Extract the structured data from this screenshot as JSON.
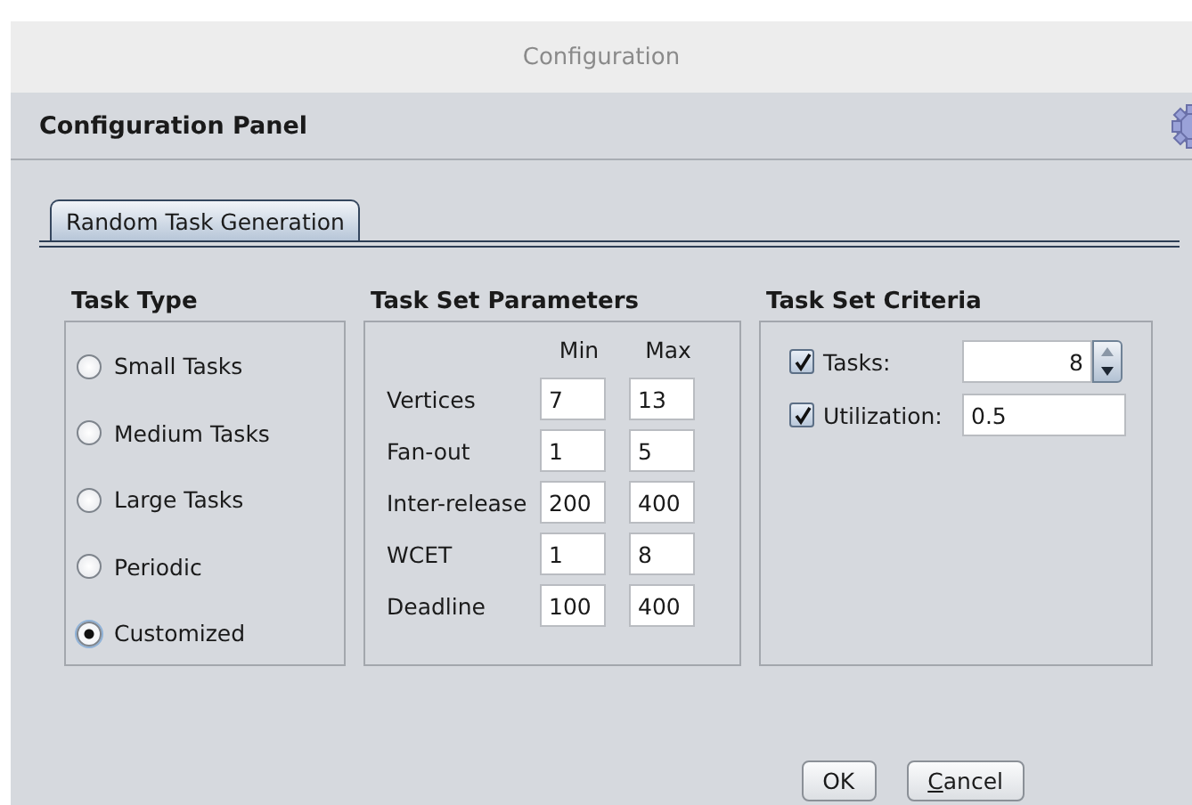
{
  "window": {
    "title": "Configuration"
  },
  "header": {
    "title": "Configuration Panel"
  },
  "tabs": [
    {
      "label": "Random Task Generation",
      "selected": true
    }
  ],
  "task_type": {
    "title": "Task Type",
    "options": [
      {
        "label": "Small Tasks",
        "selected": false
      },
      {
        "label": "Medium Tasks",
        "selected": false
      },
      {
        "label": "Large Tasks",
        "selected": false
      },
      {
        "label": "Periodic",
        "selected": false
      },
      {
        "label": "Customized",
        "selected": true
      }
    ]
  },
  "parameters": {
    "title": "Task Set Parameters",
    "columns": [
      "Min",
      "Max"
    ],
    "rows": [
      {
        "label": "Vertices",
        "min": "7",
        "max": "13"
      },
      {
        "label": "Fan-out",
        "min": "1",
        "max": "5"
      },
      {
        "label": "Inter-release",
        "min": "200",
        "max": "400"
      },
      {
        "label": "WCET",
        "min": "1",
        "max": "8"
      },
      {
        "label": "Deadline",
        "min": "100",
        "max": "400"
      }
    ]
  },
  "criteria": {
    "title": "Task Set Criteria",
    "items": [
      {
        "kind": "spinner",
        "label": "Tasks:",
        "checked": true,
        "value": "8"
      },
      {
        "kind": "field",
        "label": "Utilization:",
        "checked": true,
        "value": "0.5"
      }
    ]
  },
  "buttons": [
    {
      "label": "OK"
    },
    {
      "label": "Cancel",
      "mnemonic": true
    }
  ]
}
